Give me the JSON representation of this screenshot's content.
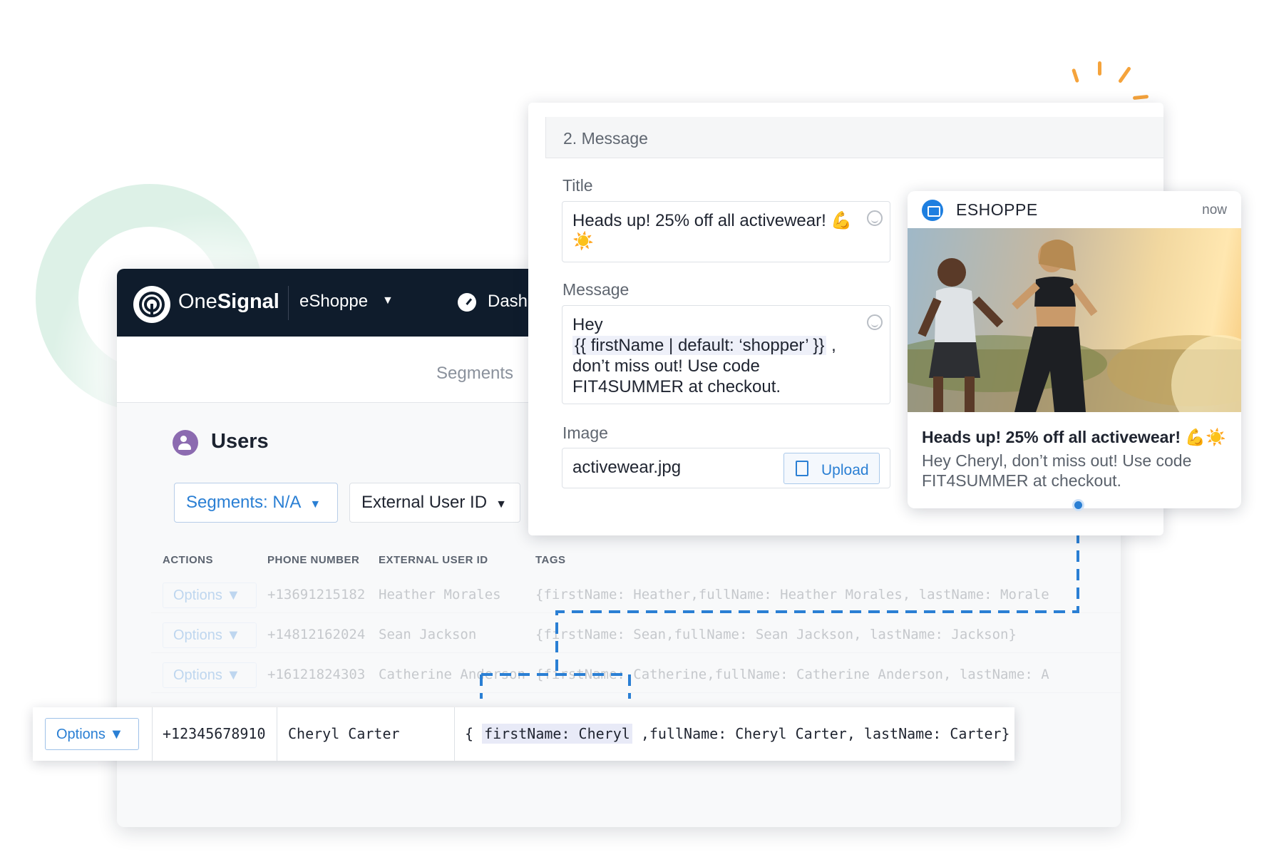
{
  "dashboard": {
    "brand_word1": "One",
    "brand_word2": "Signal",
    "app_name": "eShoppe",
    "nav_item": "Dash",
    "subnav_tab": "Segments",
    "page_title": "Users",
    "segment_filter": "Segments: N/A",
    "field_filter": "External User ID",
    "columns": [
      "ACTIONS",
      "PHONE NUMBER",
      "EXTERNAL USER ID",
      "TAGS"
    ],
    "rows": [
      {
        "action": "Options",
        "phone": "+13691215182",
        "external_id": "Heather Morales",
        "tags": "{firstName: Heather,fullName: Heather Morales, lastName: Morale"
      },
      {
        "action": "Options",
        "phone": "+14812162024",
        "external_id": "Sean Jackson",
        "tags": "{firstName: Sean,fullName: Sean Jackson, lastName: Jackson}"
      },
      {
        "action": "Options",
        "phone": "+16121824303",
        "external_id": "Catherine Anderson",
        "tags": "{firstName: Catherine,fullName: Catherine Anderson, lastName: A"
      }
    ],
    "highlighted_row": {
      "action": "Options",
      "phone": "+12345678910",
      "external_id": "Cheryl Carter",
      "tags_open": "{ ",
      "tags_highlight": "firstName: Cheryl",
      "tags_rest": " ,fullName: Cheryl Carter, lastName: Carter}"
    }
  },
  "message_form": {
    "section_title": "2. Message",
    "title_label": "Title",
    "title_value": "Heads up! 25% off all activewear! 💪☀️",
    "message_label": "Message",
    "message_line1": "Hey",
    "message_variable": "{{ firstName | default: ‘shopper’ }}",
    "message_after_var": " ,",
    "message_line3": "don’t miss out! Use code",
    "message_line4": "FIT4SUMMER at checkout.",
    "image_label": "Image",
    "image_value": "activewear.jpg",
    "upload_label": "Upload"
  },
  "notification": {
    "app_name": "ESHOPPE",
    "time": "now",
    "title": "Heads up! 25% off all activewear! 💪☀️",
    "body": "Hey Cheryl, don’t miss out! Use code FIT4SUMMER at checkout."
  },
  "colors": {
    "accent": "#2a7fd4",
    "nav_bg": "#0f1c2c",
    "spark": "#f5a33b",
    "ring": "#d9f0e4",
    "users_icon": "#8c6bb0"
  },
  "icons": [
    "onesignal-logo-icon",
    "caret-down-icon",
    "dashboard-gauge-icon",
    "users-icon",
    "emoji-smile-icon",
    "upload-icon",
    "shop-icon"
  ]
}
